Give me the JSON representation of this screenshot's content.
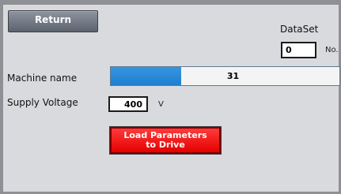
{
  "toolbar": {
    "return_label": "Return"
  },
  "dataset": {
    "label": "DataSet",
    "value": "0",
    "unit": "No."
  },
  "machine": {
    "label": "Machine name",
    "value": "31"
  },
  "voltage": {
    "label": "Supply Voltage",
    "value": "400",
    "unit": "V"
  },
  "load_button": {
    "line1": "Load Parameters",
    "line2": "to Drive"
  },
  "colors": {
    "background": "#d8dadd",
    "machine_fill": "#1f7fd0",
    "load_button": "#e40000",
    "return_button": "#6a707a"
  }
}
